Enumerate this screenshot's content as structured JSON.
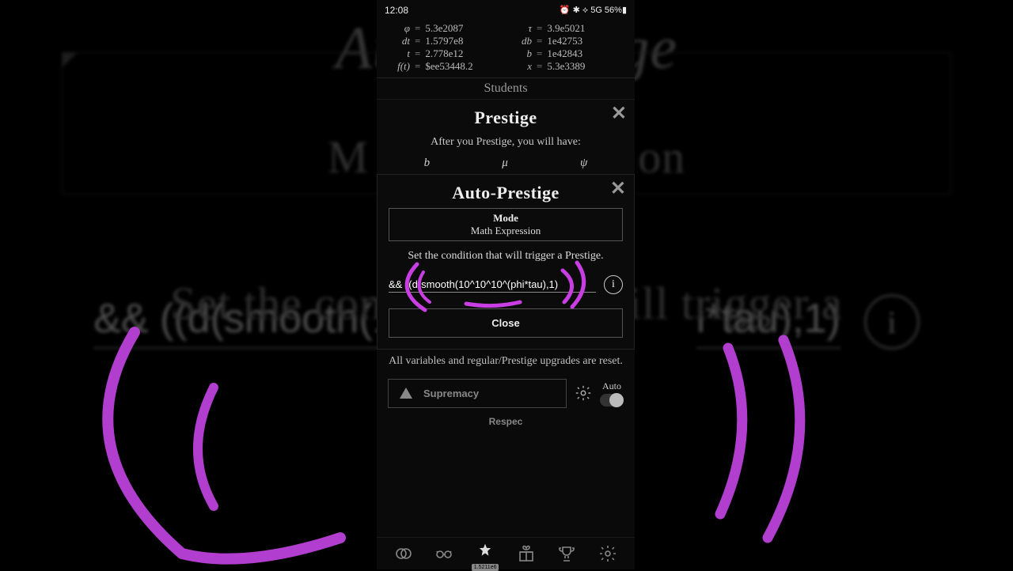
{
  "status": {
    "time": "12:08",
    "right": "⏰ ✱ ⟡ 5G  56%▮"
  },
  "vars": {
    "left": [
      {
        "sym": "φ",
        "val": "5.3e2087"
      },
      {
        "sym": "dt",
        "val": "1.5797e8"
      },
      {
        "sym": "t",
        "val": "2.778e12"
      },
      {
        "sym": "f(t)",
        "val": "$ee53448.2"
      }
    ],
    "right": [
      {
        "sym": "τ",
        "val": "3.9e5021"
      },
      {
        "sym": "db",
        "val": "1e42753"
      },
      {
        "sym": "b",
        "val": "1e42843"
      },
      {
        "sym": "x",
        "val": "5.3e3389"
      }
    ]
  },
  "students": "Students",
  "prestige": {
    "title": "Prestige",
    "hint": "After you Prestige, you will have:",
    "syms": [
      "b",
      "μ",
      "ψ"
    ]
  },
  "auto": {
    "title": "Auto-Prestige",
    "mode_label": "Mode",
    "mode_value": "Math Expression",
    "cond": "Set the condition that will trigger a Prestige.",
    "expr": "&& ((d(smooth(10^10^10^(phi*tau),1)",
    "close": "Close"
  },
  "reset_note": "All variables and regular/Prestige upgrades are reset.",
  "supremacy": "Supremacy",
  "auto_label": "Auto",
  "respec": "Respec",
  "star_badge": "1.5211e6",
  "bg": {
    "title": "Auto-Prestige",
    "sub_a": "Set the cond",
    "sub_b": "ill trigger a",
    "sub_mid": "on",
    "sub_left": "M",
    "expr_a": "&& ((d(smooth(1",
    "expr_b": "i*tau),1)"
  }
}
